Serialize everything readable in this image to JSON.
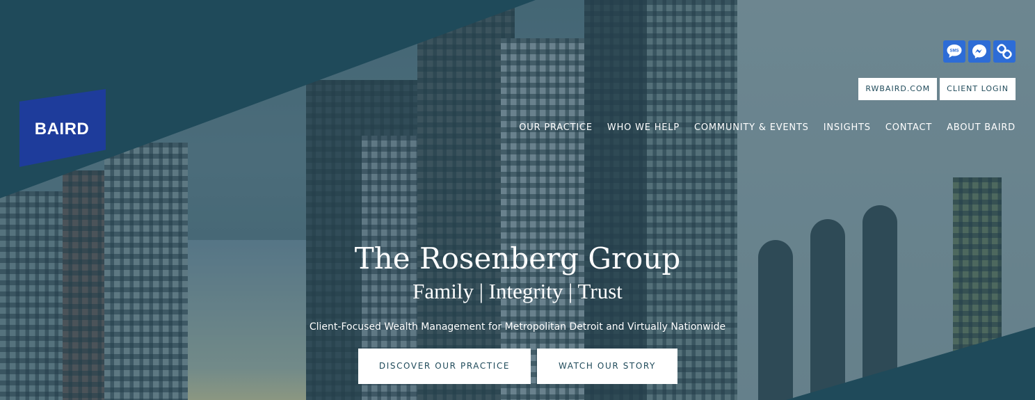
{
  "brand": {
    "logo_text": "BAIRD"
  },
  "social": [
    {
      "icon": "sms-icon",
      "label": "SMS"
    },
    {
      "icon": "messenger-icon",
      "label": ""
    },
    {
      "icon": "link-icon",
      "label": ""
    }
  ],
  "utility": {
    "rwbaird": "RWBAIRD.COM",
    "client_login": "CLIENT LOGIN"
  },
  "nav": [
    "OUR PRACTICE",
    "WHO WE HELP",
    "COMMUNITY & EVENTS",
    "INSIGHTS",
    "CONTACT",
    "ABOUT BAIRD"
  ],
  "hero": {
    "title": "The Rosenberg Group",
    "tagline": "Family | Integrity | Trust",
    "subtitle": "Client-Focused Wealth Management for Metropolitan Detroit and Virtually Nationwide",
    "cta_discover": "DISCOVER OUR PRACTICE",
    "cta_watch": "WATCH OUR STORY"
  },
  "colors": {
    "accent": "#1f4a5a",
    "logo_blue": "#1e3c9b",
    "social_blue": "#2d6cd6",
    "text_light": "#ffffff"
  }
}
